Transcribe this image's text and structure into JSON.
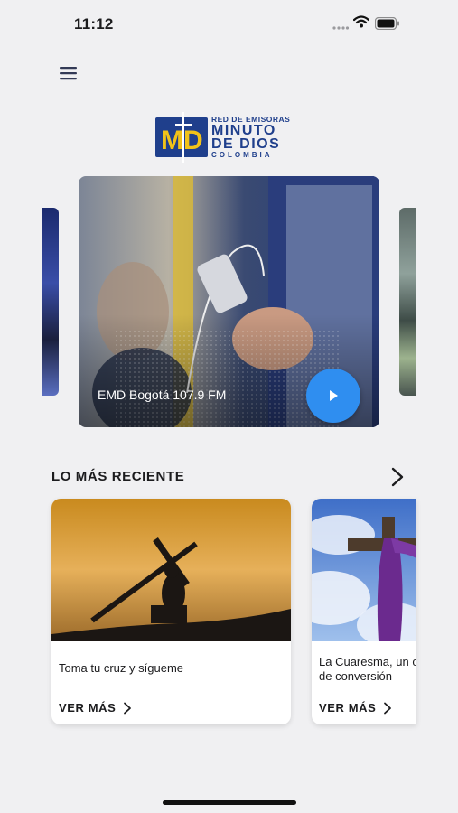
{
  "status": {
    "time": "11:12"
  },
  "header": {
    "menu_icon": "hamburger-menu-icon",
    "logo": {
      "mark": "MD",
      "line1": "RED DE EMISORAS",
      "line2": "MINUTO",
      "line3": "DE DIOS",
      "line4": "COLOMBIA"
    }
  },
  "carousel": {
    "current": {
      "title": "EMD Bogotá 107.9 FM",
      "play_icon": "play-icon"
    }
  },
  "recent": {
    "title": "LO MÁS RECIENTE",
    "arrow_icon": "chevron-right-icon",
    "items": [
      {
        "title": "Toma tu cruz y sígueme",
        "cta": "VER MÁS"
      },
      {
        "title": "La Cuaresma, un camino de conversión",
        "cta": "VER MÁS"
      }
    ]
  },
  "colors": {
    "accent": "#2f8ef0",
    "brand_blue": "#1f3f8c",
    "brand_yellow": "#f1c319"
  }
}
